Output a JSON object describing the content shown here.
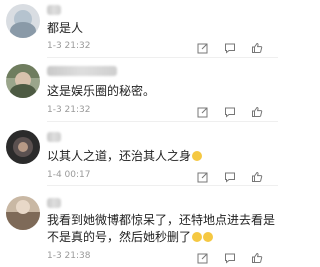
{
  "comments": [
    {
      "text": "都是人",
      "time": "1-3 21:32"
    },
    {
      "text": "这是娱乐圈的秘密。",
      "time": "1-3 21:32"
    },
    {
      "text": "以其人之道，还治其人之身",
      "time": "1-4 00:17"
    },
    {
      "line1": "我看到她微博都惊呆了，还特地点进去看是",
      "line2": "不是真的号，然后她秒删了",
      "time": "1-3 21:38"
    }
  ],
  "icons": [
    "share-icon",
    "comment-icon",
    "like-icon"
  ],
  "colors": {
    "text": "#1f1f1f",
    "meta": "#9a9a9a",
    "divider": "#efefef",
    "emoji": "#f5c842"
  }
}
